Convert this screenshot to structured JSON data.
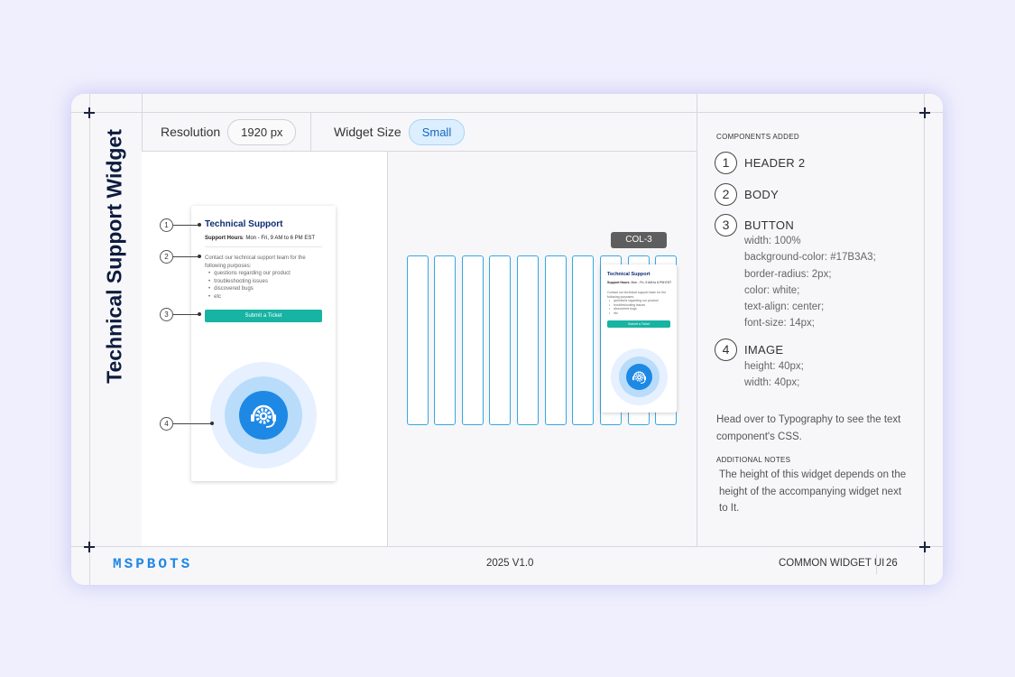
{
  "page_title": "Technical Support Widget",
  "toolbar": {
    "resolution_label": "Resolution",
    "resolution_value": "1920 px",
    "widget_size_label": "Widget Size",
    "widget_size_value": "Small"
  },
  "widget": {
    "title": "Technical Support",
    "hours_label": "Support Hours",
    "hours_value": ": Mon - Fri, 9 AM to 6 PM EST",
    "body_intro": "Contact our technical support team for the following purposes:",
    "body_items": [
      "questions regarding our product",
      "troubleshooting issues",
      "discovered bugs",
      "etc"
    ],
    "button_label": "Submit a Ticket",
    "image_icon": "headset-gear-icon"
  },
  "callouts": [
    "1",
    "2",
    "3",
    "4"
  ],
  "grid": {
    "column_count": 10,
    "column_tag": "COL-3"
  },
  "components_panel": {
    "heading": "COMPONENTS ADDED",
    "components": [
      {
        "number": "1",
        "name": "HEADER 2",
        "props": []
      },
      {
        "number": "2",
        "name": "BODY",
        "props": []
      },
      {
        "number": "3",
        "name": "BUTTON",
        "props": [
          "width: 100%",
          "background-color: #17B3A3;",
          "border-radius: 2px;",
          "color: white;",
          "text-align: center;",
          "font-size: 14px;"
        ]
      },
      {
        "number": "4",
        "name": "IMAGE",
        "props": [
          "height: 40px;",
          "width: 40px;"
        ]
      }
    ],
    "typography_note": "Head over to Typography to see the text component's CSS.",
    "additional_heading": "ADDITIONAL NOTES",
    "additional_note": "The height of this widget depends on the height of the accompanying widget next to It."
  },
  "footer": {
    "brand": "MSPBOTS",
    "version": "2025 V1.0",
    "section": "COMMON WIDGET UI",
    "page_number": "26"
  },
  "colors": {
    "accent": "#17B3A3",
    "title_navy": "#0D1B3E",
    "brand_blue": "#1E88E5",
    "grid_blue": "#35A8E0"
  }
}
